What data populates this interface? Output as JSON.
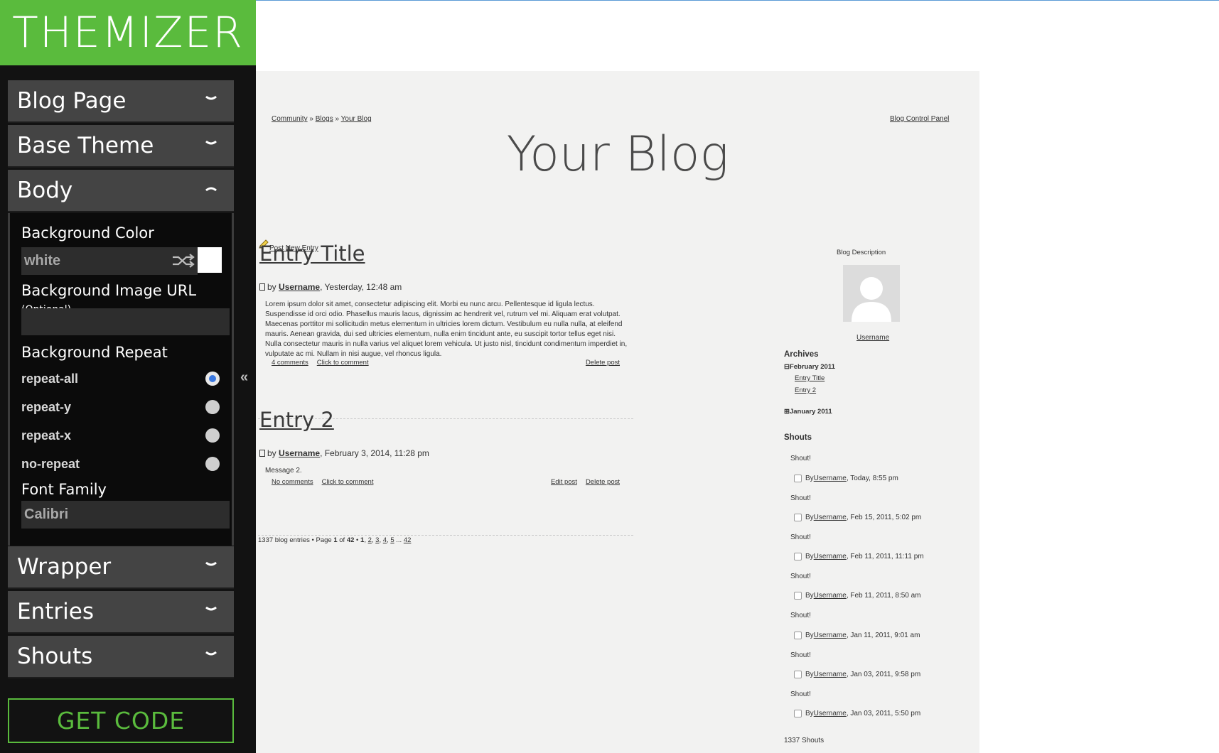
{
  "app": {
    "logo": "THEMIZER",
    "collapse_glyph": "«",
    "get_code": "GET CODE"
  },
  "sections": {
    "blog_page": "Blog Page",
    "base_theme": "Base Theme",
    "body": "Body",
    "wrapper": "Wrapper",
    "entries": "Entries",
    "shouts": "Shouts"
  },
  "body_settings": {
    "bg_color_label": "Background Color",
    "bg_color_value": "white",
    "bg_color_swatch": "#ffffff",
    "bg_image_label": "Background Image URL",
    "bg_image_optional": "(Optional)",
    "bg_image_value": "",
    "bg_repeat_label": "Background Repeat",
    "repeat_options": [
      {
        "label": "repeat-all",
        "selected": true
      },
      {
        "label": "repeat-y",
        "selected": false
      },
      {
        "label": "repeat-x",
        "selected": false
      },
      {
        "label": "no-repeat",
        "selected": false
      }
    ],
    "font_family_label": "Font Family",
    "font_family_value": "Calibri"
  },
  "colors": {
    "accent_green": "#5abb3d",
    "panel_bg": "#121212",
    "radio_selected": "#3a78e0"
  },
  "preview": {
    "breadcrumb": {
      "community": "Community",
      "sep1": " » ",
      "blogs": "Blogs",
      "sep2": " » ",
      "your_blog": "Your Blog"
    },
    "control_panel": "Blog Control Panel",
    "title": "Your Blog",
    "post_new": "Post New Entry",
    "entries": [
      {
        "title": "Entry Title",
        "by": "by",
        "author": "Username",
        "date": ", Yesterday, 12:48 am",
        "body": "Lorem ipsum dolor sit amet, consectetur adipiscing elit. Morbi eu nunc arcu. Pellentesque id ligula lectus. Suspendisse id orci odio. Phasellus mauris lacus, dignissim ac hendrerit vel, rutrum vel mi. Aliquam erat volutpat. Maecenas porttitor mi sollicitudin metus elementum in ultricies lorem dictum. Vestibulum eu nulla nulla, at eleifend mauris. Aenean gravida, dui sed ultricies elementum, nulla enim tincidunt ante, eu suscipit tortor tellus eget nisi. Nulla consectetur mauris in nulla varius vel aliquet lorem vehicula. Ut justo nisl, tincidunt condimentum imperdiet in, vulputate ac mi. Nullam in nisi augue, vel rhoncus ligula.",
        "comments": "4 comments",
        "click_comment": "Click to comment",
        "edit": "",
        "delete": "Delete post"
      },
      {
        "title": "Entry 2",
        "by": "by",
        "author": "Username",
        "date": ", February 3, 2014, 11:28 pm",
        "body": "Message 2.",
        "comments": "No comments",
        "click_comment": "Click to comment",
        "edit": "Edit post",
        "delete": "Delete post"
      }
    ],
    "pager": {
      "prefix": "1337 blog entries • Page ",
      "current": "1",
      "of": " of ",
      "total": "42",
      "sep": " • ",
      "pages": [
        "1",
        "2",
        "3",
        "4",
        "5"
      ],
      "ellipsis": " ... ",
      "last": "42"
    },
    "sidebar": {
      "description": "Blog Description",
      "username": "Username",
      "archives_heading": "Archives",
      "archive_groups": [
        {
          "label": "February 2011",
          "toggle": "⊟",
          "items": [
            "Entry Title",
            "Entry 2"
          ]
        },
        {
          "label": "January 2011",
          "toggle": "⊞",
          "items": []
        }
      ],
      "shouts_heading": "Shouts",
      "shouts": [
        {
          "text": "Shout!",
          "by": "By ",
          "user": "Username",
          "date": ", Today, 8:55 pm"
        },
        {
          "text": "Shout!",
          "by": "By ",
          "user": "Username",
          "date": ", Feb 15, 2011, 5:02 pm"
        },
        {
          "text": "Shout!",
          "by": "By ",
          "user": "Username",
          "date": ", Feb 11, 2011, 11:11 pm"
        },
        {
          "text": "Shout!",
          "by": "By ",
          "user": "Username",
          "date": ", Feb 11, 2011, 8:50 am"
        },
        {
          "text": "Shout!",
          "by": "By ",
          "user": "Username",
          "date": ", Jan 11, 2011, 9:01 am"
        },
        {
          "text": "Shout!",
          "by": "By ",
          "user": "Username",
          "date": ", Jan 03, 2011, 9:58 pm"
        },
        {
          "text": "Shout!",
          "by": "By ",
          "user": "Username",
          "date": ", Jan 03, 2011, 5:50 pm"
        }
      ],
      "shout_count": "1337 Shouts"
    }
  }
}
